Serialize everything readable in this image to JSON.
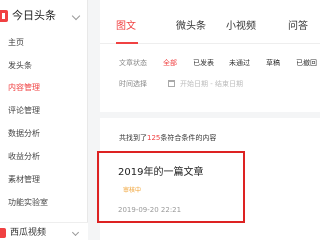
{
  "sidebar": {
    "brand": "今日头条",
    "items": [
      {
        "label": "主页",
        "active": false
      },
      {
        "label": "发头条",
        "active": false
      },
      {
        "label": "内容管理",
        "active": true
      },
      {
        "label": "评论管理",
        "active": false
      },
      {
        "label": "数据分析",
        "active": false
      },
      {
        "label": "收益分析",
        "active": false
      },
      {
        "label": "素材管理",
        "active": false
      },
      {
        "label": "功能实验室",
        "active": false
      }
    ],
    "section2_title": "西瓜视频"
  },
  "tabs": [
    {
      "label": "图文",
      "active": true
    },
    {
      "label": "微头条",
      "active": false
    },
    {
      "label": "小视频",
      "active": false
    },
    {
      "label": "问答",
      "active": false
    }
  ],
  "filters": {
    "status_label": "文章状态",
    "options": [
      {
        "label": "全部",
        "active": true
      },
      {
        "label": "已发表",
        "active": false
      },
      {
        "label": "未通过",
        "active": false
      },
      {
        "label": "草稿",
        "active": false
      },
      {
        "label": "已撤回",
        "active": false
      }
    ],
    "time_label": "时间选择",
    "date_placeholder": "开始日期 - 结束日期"
  },
  "results": {
    "prefix": "共找到了",
    "count": "125",
    "suffix": "条符合条件的内容"
  },
  "article": {
    "title": "2019年的一篇文章",
    "status": "审核中",
    "time": "2019-09-20 22:21"
  },
  "colors": {
    "accent": "#f04142",
    "highlight_border": "#dd2222",
    "status": "#f0a030"
  }
}
